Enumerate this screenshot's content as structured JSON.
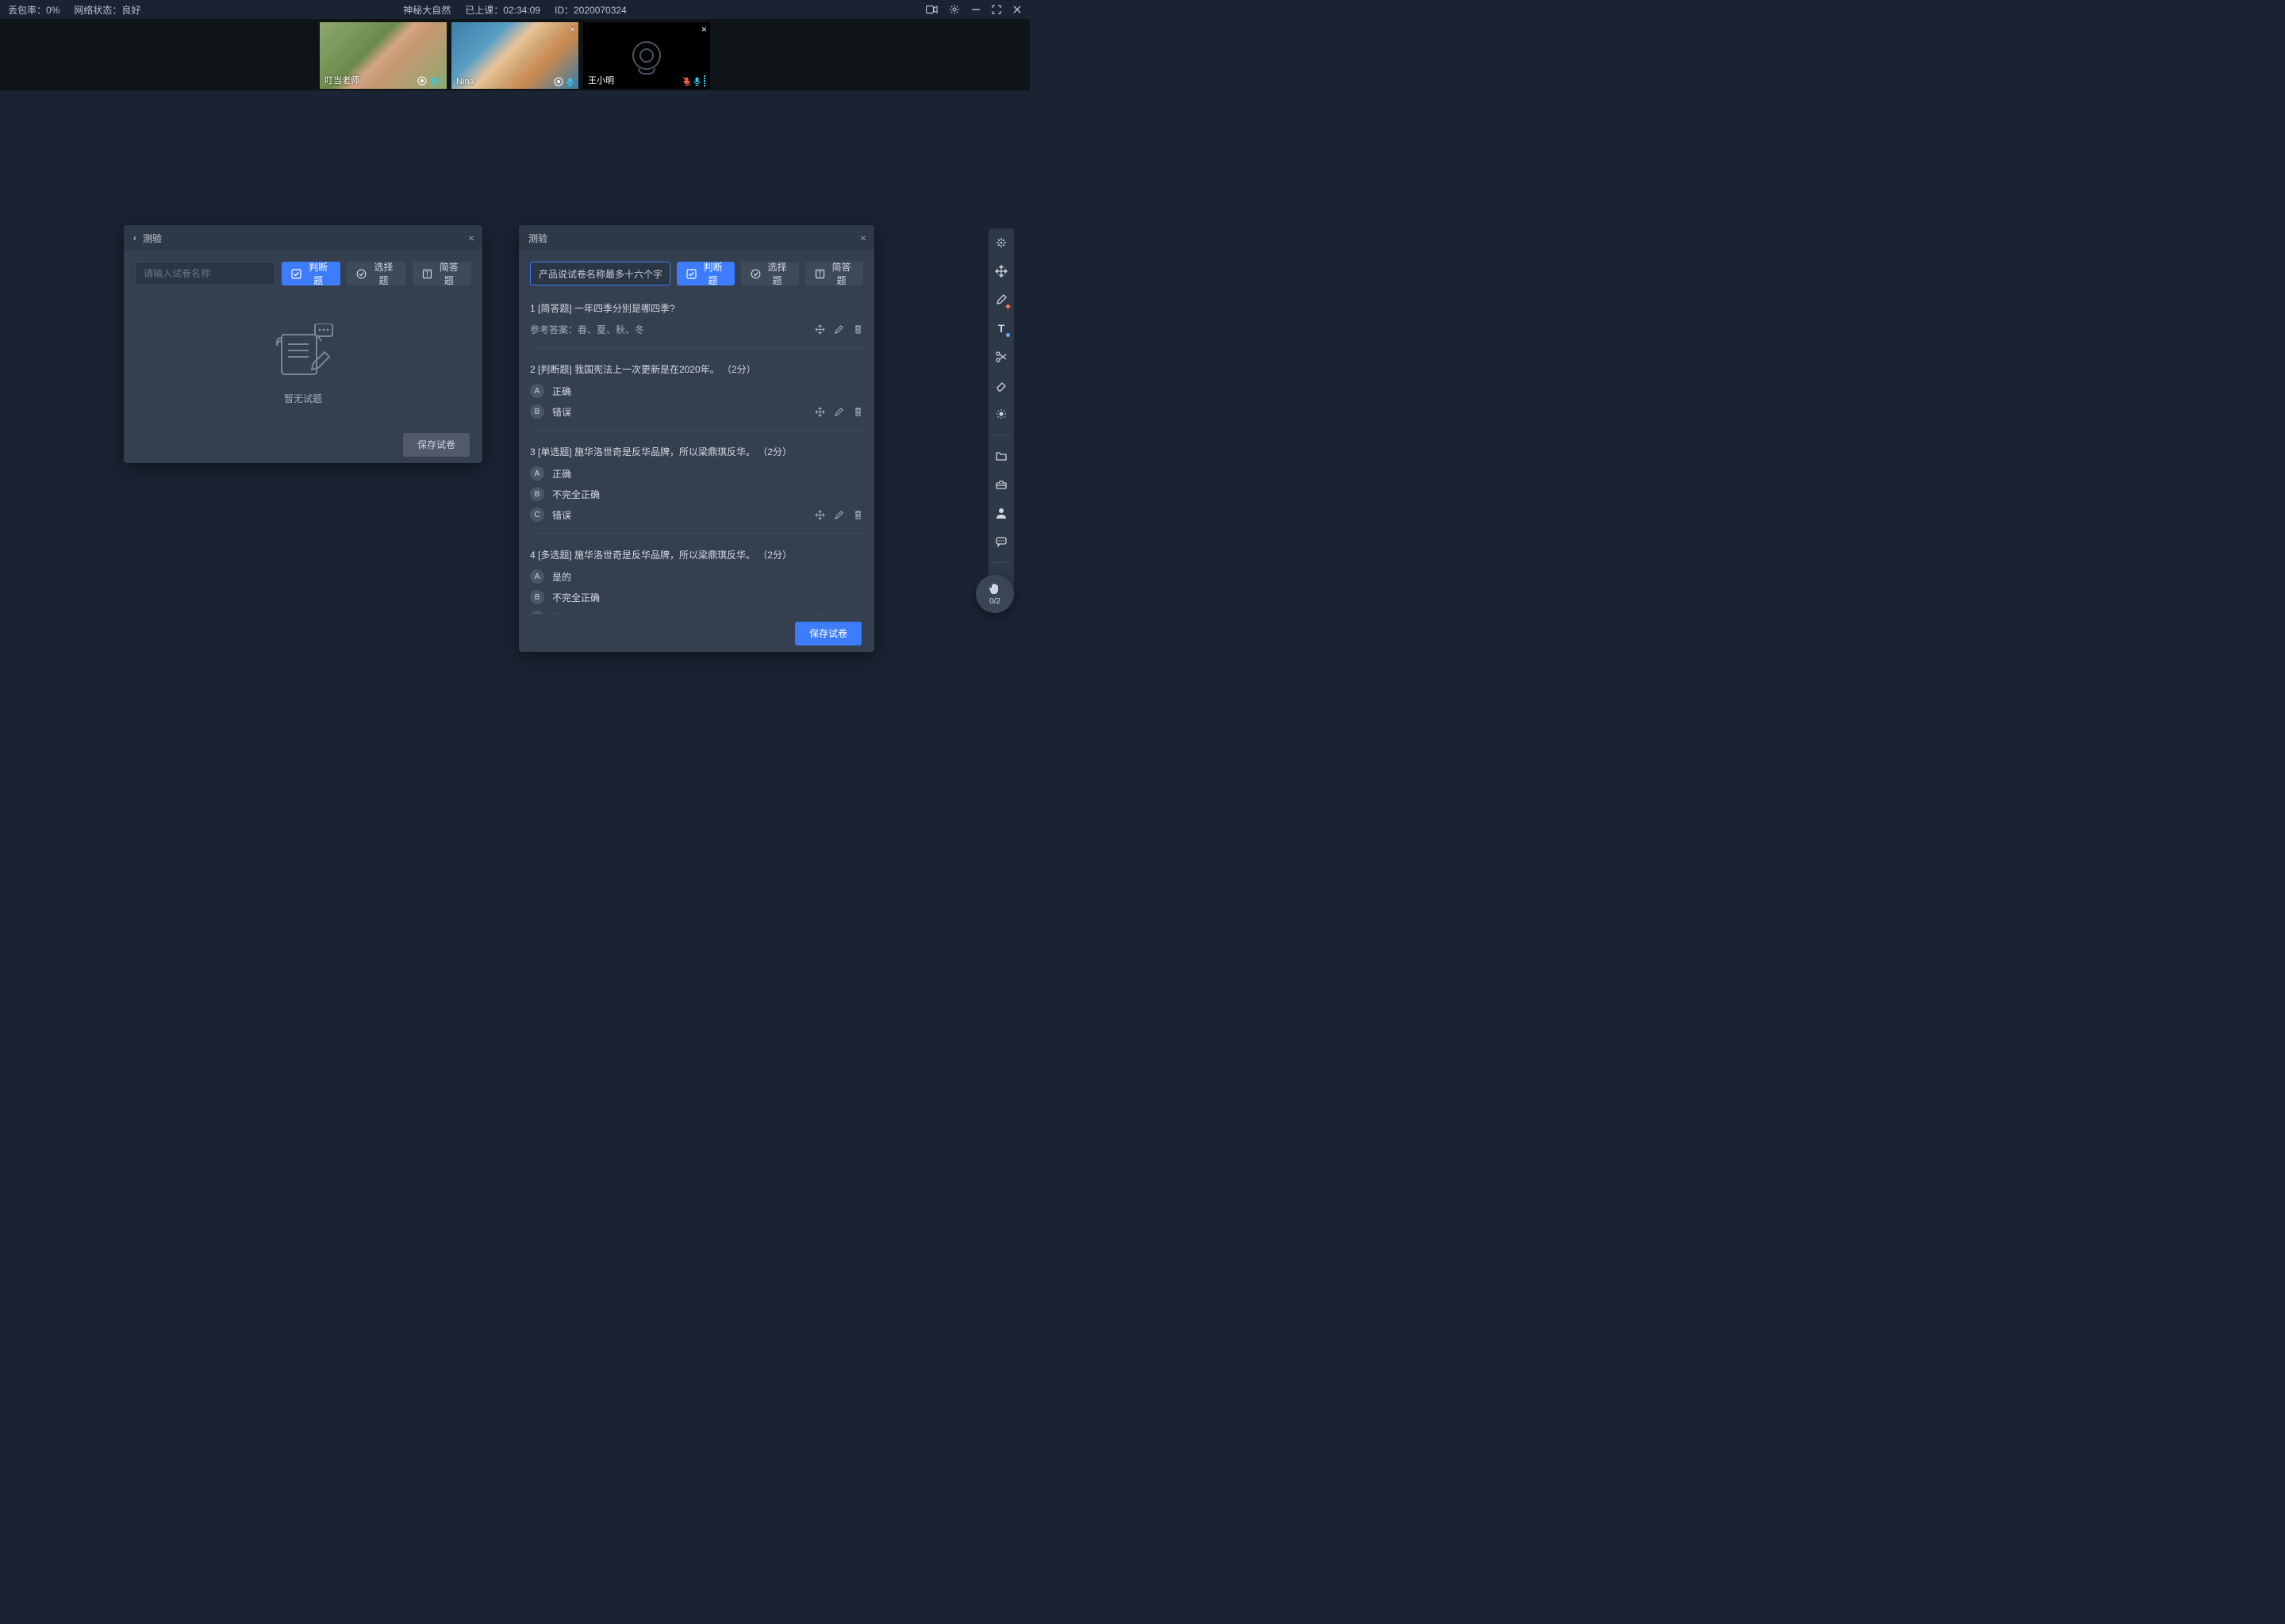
{
  "topbar": {
    "packet_loss_label": "丢包率：0%",
    "network_label": "网络状态：良好",
    "class_title": "神秘大自然",
    "elapsed_label": "已上课：02:34:09",
    "session_id_label": "ID：2020070324"
  },
  "videos": [
    {
      "name": "叮当老师",
      "kind": "face-1",
      "closeable": false,
      "muted": false
    },
    {
      "name": "Nina",
      "kind": "face-2",
      "closeable": true,
      "muted": false
    },
    {
      "name": "王小明",
      "kind": "cam-off",
      "closeable": true,
      "muted": true
    }
  ],
  "panel_left": {
    "title": "测验",
    "placeholder": "请输入试卷名称",
    "btn_truefalse": "判断题",
    "btn_choice": "选择题",
    "btn_short": "简答题",
    "empty_text": "暂无试题",
    "save_label": "保存试卷"
  },
  "panel_right": {
    "title": "测验",
    "name_value": "产品说试卷名称最多十六个字",
    "btn_truefalse": "判断题",
    "btn_choice": "选择题",
    "btn_short": "简答题",
    "save_label": "保存试卷",
    "questions": [
      {
        "num": "1",
        "tag": "[简答题]",
        "text": "一年四季分别是哪四季?",
        "answer_label": "参考答案：春、夏、秋、冬",
        "options": []
      },
      {
        "num": "2",
        "tag": "[判断题]",
        "text": "我国宪法上一次更新是在2020年。",
        "points": "（2分）",
        "options": [
          {
            "letter": "A",
            "text": "正确"
          },
          {
            "letter": "B",
            "text": "错误"
          }
        ]
      },
      {
        "num": "3",
        "tag": "[单选题]",
        "text": "施华洛世奇是反华品牌，所以梁鼎琪反华。",
        "points": "（2分）",
        "options": [
          {
            "letter": "A",
            "text": "正确"
          },
          {
            "letter": "B",
            "text": "不完全正确"
          },
          {
            "letter": "C",
            "text": "错误"
          }
        ]
      },
      {
        "num": "4",
        "tag": "[多选题]",
        "text": "施华洛世奇是反华品牌，所以梁鼎琪反华。",
        "points": "（2分）",
        "options": [
          {
            "letter": "A",
            "text": "是的"
          },
          {
            "letter": "B",
            "text": "不完全正确"
          },
          {
            "letter": "C",
            "text": "错误"
          }
        ]
      }
    ]
  },
  "hand": {
    "count": "0/2"
  }
}
